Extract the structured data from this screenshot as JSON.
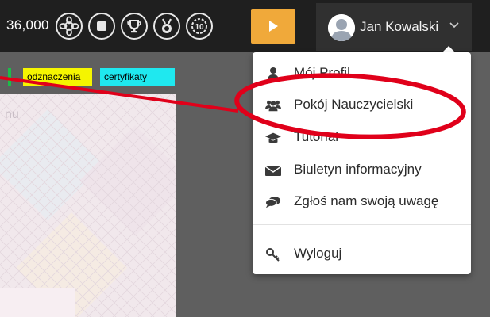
{
  "header": {
    "score": "36,000",
    "badges": [
      {
        "name": "flower-badge-icon"
      },
      {
        "name": "stop-badge-icon"
      },
      {
        "name": "trophy-badge-icon"
      },
      {
        "name": "medal-badge-icon"
      },
      {
        "name": "ten-badge-icon",
        "label": "10"
      }
    ],
    "play_icon": "play-icon",
    "accent": "#f0a93a",
    "user_name": "Jan Kowalski"
  },
  "tabs": {
    "achievements": "odznaczenia",
    "certificates": "certyfikaty"
  },
  "content": {
    "partial_text": "nu"
  },
  "menu": {
    "items": [
      {
        "label": "Mój Profil",
        "icon": "user-icon"
      },
      {
        "label": "Pokój Nauczycielski",
        "icon": "users-icon"
      },
      {
        "label": "Tutorial",
        "icon": "graduation-cap-icon"
      },
      {
        "label": "Biuletyn informacyjny",
        "icon": "envelope-icon"
      },
      {
        "label": "Zgłoś nam swoją uwagę",
        "icon": "comments-icon"
      },
      {
        "label": "Wyloguj",
        "icon": "key-icon"
      }
    ]
  },
  "colors": {
    "annotation": "#e0001a",
    "tag_yellow": "#f5f500",
    "tag_cyan": "#1fe8ef",
    "tag_green": "#1bbd4a"
  }
}
